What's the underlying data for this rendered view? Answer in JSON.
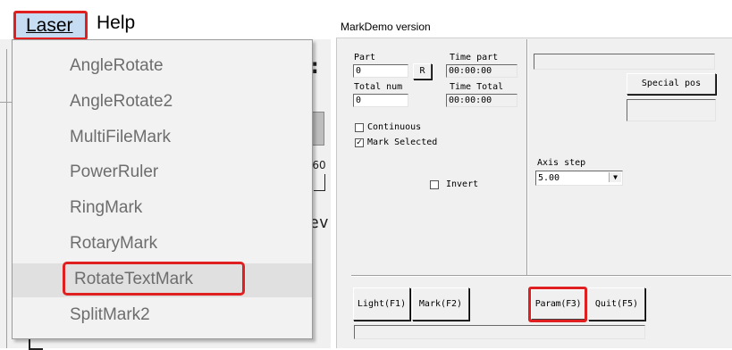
{
  "menubar": {
    "laser": "Laser",
    "help": "Help"
  },
  "dropdown": {
    "items": [
      "AngleRotate",
      "AngleRotate2",
      "MultiFileMark",
      "PowerRuler",
      "RingMark",
      "RotaryMark",
      "RotateTextMark",
      "SplitMark2"
    ],
    "highlighted": "RotateTextMark"
  },
  "background": {
    "colon": ":",
    "tick": "-60",
    "ev": "ev"
  },
  "dialog": {
    "title": "MarkDemo version",
    "part_label": "Part",
    "part_value": "0",
    "r_button": "R",
    "time_part_label": "Time part",
    "time_part_value": "00:00:00",
    "total_num_label": "Total num",
    "total_num_value": "0",
    "time_total_label": "Time Total",
    "time_total_value": "00:00:00",
    "special_pos_button": "Special pos",
    "continuous_label": "Continuous",
    "continuous_checked": false,
    "mark_selected_label": "Mark Selected",
    "mark_selected_checked": true,
    "invert_label": "Invert",
    "invert_checked": false,
    "axis_step_label": "Axis step",
    "axis_step_value": "5.00",
    "light_button": "Light(F1)",
    "mark_button": "Mark(F2)",
    "param_button": "Param(F3)",
    "quit_button": "Quit(F5)"
  },
  "colors": {
    "highlight": "#e02020",
    "menu_active_bg": "#c6dcf2"
  }
}
